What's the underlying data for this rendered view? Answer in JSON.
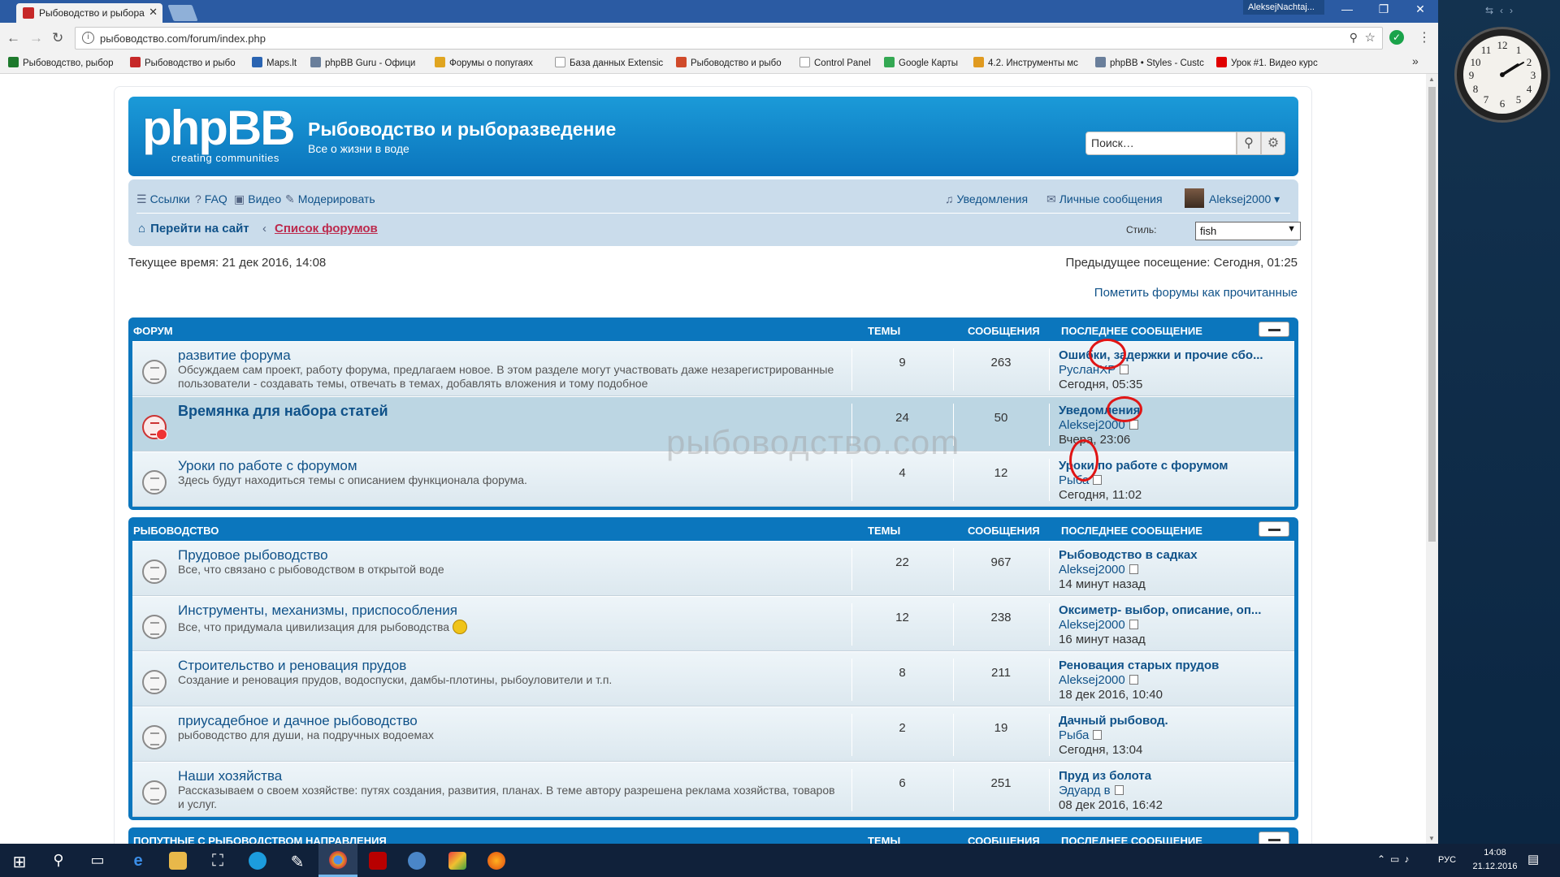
{
  "browser": {
    "tabs": [
      {
        "label": "Рыбоводство и рыбора",
        "close": "✕"
      }
    ],
    "window_user": "AleksejNachtaj...",
    "window_controls": {
      "minimize": "—",
      "maximize": "❐",
      "close": "✕"
    },
    "nav": {
      "back": "←",
      "forward": "→",
      "reload": "↻"
    },
    "url": "рыбоводство.com/forum/index.php",
    "bookmarks": [
      {
        "label": "Рыбоводство, рыбор",
        "color": "#1e7a2d"
      },
      {
        "label": "Рыбоводство и рыбо",
        "color": "#c62828"
      },
      {
        "label": "Maps.lt",
        "color": "#2a64b2"
      },
      {
        "label": "phpBB Guru - Офици",
        "color": "#6a7f9b"
      },
      {
        "label": "Форумы о попугаях",
        "color": "#e0a520"
      },
      {
        "label": "База данных Extensic",
        "color": "#ffffff"
      },
      {
        "label": "Рыбоводство и рыбо",
        "color": "#d04a2a"
      },
      {
        "label": "Control Panel",
        "color": "#ffffff"
      },
      {
        "label": "Google Карты",
        "color": "#34a853"
      },
      {
        "label": "4.2. Инструменты мс",
        "color": "#e09a20"
      },
      {
        "label": "phpBB • Styles - Custc",
        "color": "#6a7f9b"
      },
      {
        "label": "Урок #1. Видео курс",
        "color": "#e00000"
      }
    ],
    "bookmarks_more": "»"
  },
  "site": {
    "logo_main": "phpBB",
    "logo_reg": "®",
    "logo_sub": "creating communities",
    "title": "Рыбоводство и рыборазведение",
    "description": "Все о жизни в воде",
    "search_placeholder": "Поиск…"
  },
  "navbar": {
    "links": [
      {
        "label": "Ссылки",
        "icon": "☰"
      },
      {
        "label": "FAQ",
        "icon": "?"
      },
      {
        "label": "Видео",
        "icon": "▣"
      },
      {
        "label": "Модерировать",
        "icon": "✎"
      }
    ],
    "notifications": "Уведомления",
    "messages": "Личные сообщения",
    "user": "Aleksej2000",
    "user_caret": "▾",
    "crumb_home": "Перейти на сайт",
    "crumb_sep": "‹",
    "crumb_forums": "Список форумов",
    "style_label": "Стиль:",
    "style_value": "fish"
  },
  "info": {
    "current_time": "Текущее время: 21 дек 2016, 14:08",
    "last_visit": "Предыдущее посещение: Сегодня, 01:25",
    "mark_read": "Пометить форумы как прочитанные"
  },
  "watermark": "рыбоводство.com",
  "columns": {
    "topics": "ТЕМЫ",
    "posts": "СООБЩЕНИЯ",
    "last": "ПОСЛЕДНЕЕ СООБЩЕНИЕ"
  },
  "categories": [
    {
      "name": "ФОРУМ",
      "forums": [
        {
          "title": "развитие форума",
          "desc": "Обсуждаем сам проект, работу форума, предлагаем новое. В этом разделе могут участвовать даже незарегистрированные пользователи - создавать темы, отвечать в темах, добавлять вложения и тому подобное",
          "topics": "9",
          "posts": "263",
          "last_title": "Ошибки, задержки и прочие сбо...",
          "last_author": "РусланХР",
          "last_time": "Сегодня, 05:35"
        },
        {
          "title": "Времянка для набора статей",
          "desc": "",
          "topics": "24",
          "posts": "50",
          "last_title": "Уведомления",
          "last_author": "Aleksej2000",
          "last_time": "Вчера, 23:06"
        },
        {
          "title": "Уроки по работе с форумом",
          "desc": "Здесь будут находиться темы с описанием функционала форума.",
          "topics": "4",
          "posts": "12",
          "last_title": "Уроки по работе с форумом",
          "last_author": "Рыба",
          "last_time": "Сегодня, 11:02"
        }
      ]
    },
    {
      "name": "РЫБОВОДСТВО",
      "forums": [
        {
          "title": "Прудовое рыбоводство",
          "desc": "Все, что связано с рыбоводством в открытой воде",
          "topics": "22",
          "posts": "967",
          "last_title": "Рыбоводство в садках",
          "last_author": "Aleksej2000",
          "last_time": "14 минут назад"
        },
        {
          "title": "Инструменты, механизмы, приспособления",
          "desc": "Все, что придумала цивилизация для рыбоводства",
          "topics": "12",
          "posts": "238",
          "last_title": "Оксиметр- выбор, описание, оп...",
          "last_author": "Aleksej2000",
          "last_time": "16 минут назад"
        },
        {
          "title": "Строительство и реновация прудов",
          "desc": "Создание и реновация прудов, водоспуски, дамбы-плотины, рыбоуловители и т.п.",
          "topics": "8",
          "posts": "211",
          "last_title": "Реновация старых прудов",
          "last_author": "Aleksej2000",
          "last_time": "18 дек 2016, 10:40"
        },
        {
          "title": "приусадебное и дачное рыбоводство",
          "desc": "рыбоводство для души, на подручных водоемах",
          "topics": "2",
          "posts": "19",
          "last_title": "Дачный рыбовод.",
          "last_author": "Рыба",
          "last_time": "Сегодня, 13:04"
        },
        {
          "title": "Наши хозяйства",
          "desc": "Рассказываем о своем хозяйстве: путях создания, развития, планах. В теме автору разрешена реклама хозяйства, товаров и услуг.",
          "topics": "6",
          "posts": "251",
          "last_title": "Пруд из болота",
          "last_author": "Эдуард в",
          "last_time": "08 дек 2016, 16:42"
        }
      ]
    },
    {
      "name": "ПОПУТНЫЕ С РЫБОВОДСТВОМ НАПРАВЛЕНИЯ",
      "forums": []
    }
  ],
  "clock": {
    "numbers": [
      "12",
      "1",
      "2",
      "3",
      "4",
      "5",
      "6",
      "7",
      "8",
      "9",
      "10",
      "11"
    ]
  },
  "taskbar": {
    "lang": "РУС",
    "time": "14:08",
    "date": "21.12.2016"
  },
  "colors": {
    "header": "#0b76bd",
    "link": "#105289",
    "crumb_active": "#bc2a4d",
    "annotation": "#e01515"
  }
}
